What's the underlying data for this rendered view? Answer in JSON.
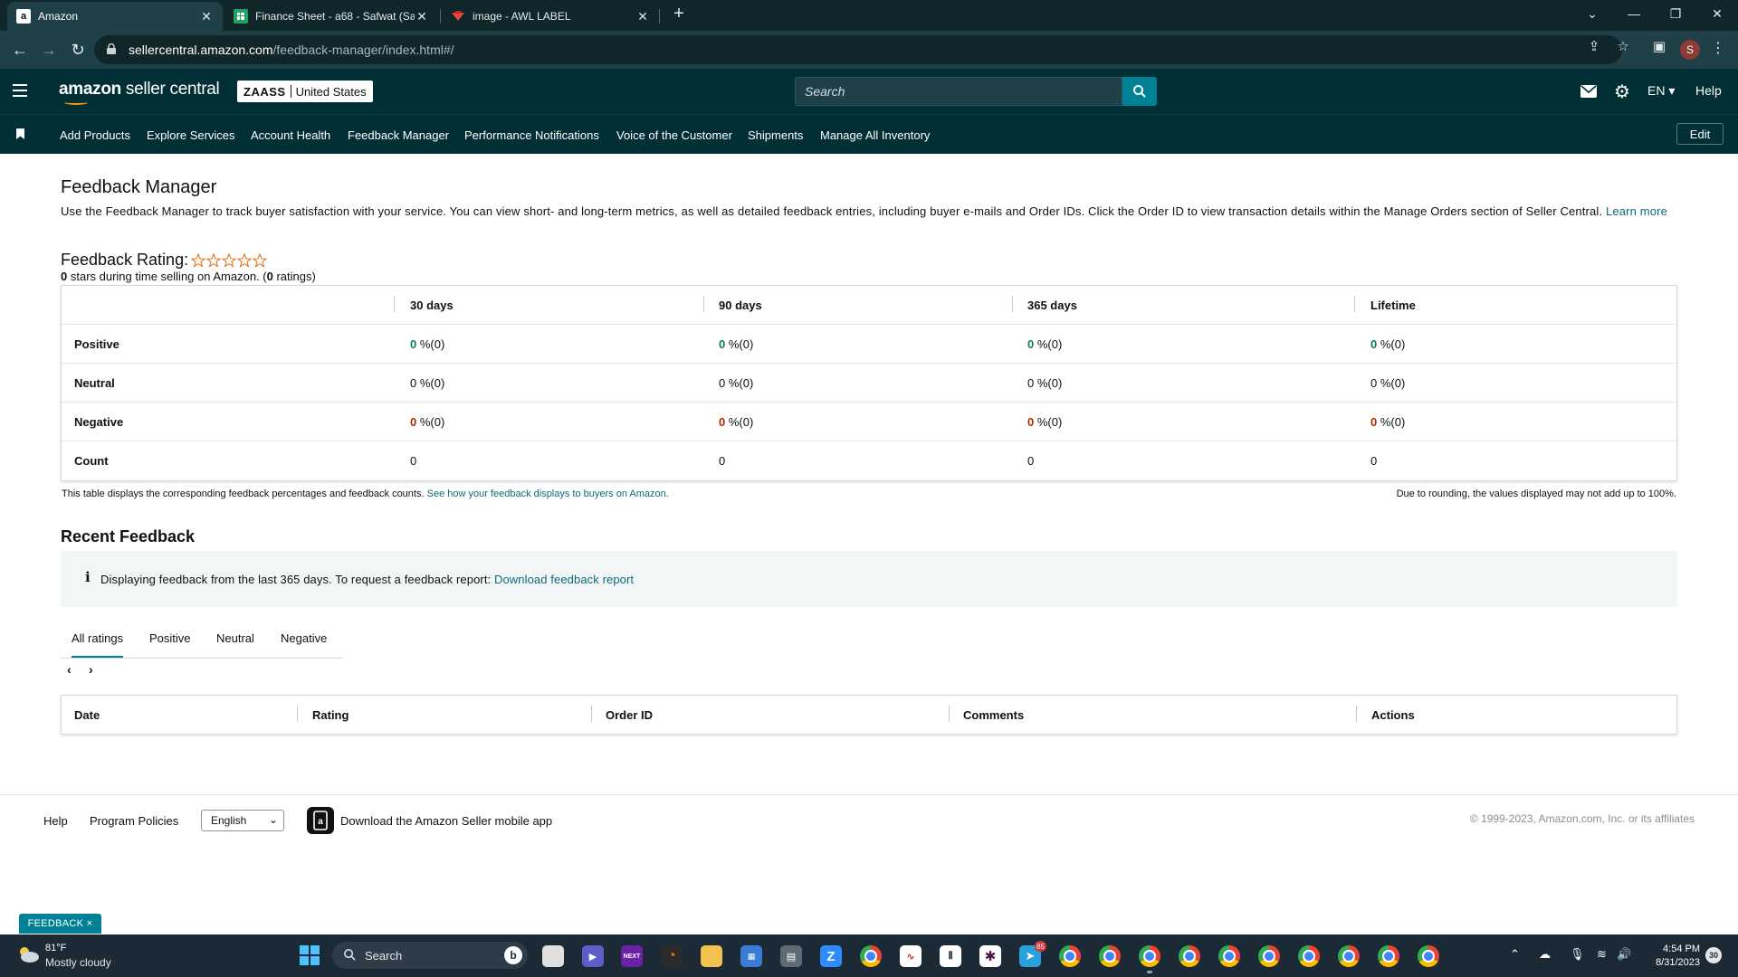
{
  "browser": {
    "tabs": [
      {
        "title": "Amazon",
        "favicon": "a"
      },
      {
        "title": "Finance Sheet - a68 - Safwat (Sar",
        "favicon": "sheets-icon"
      },
      {
        "title": "image - AWL LABEL",
        "favicon": "label-icon"
      }
    ],
    "url_domain": "sellercentral.amazon.com",
    "url_path": "/feedback-manager/index.html#/",
    "profile_initial": "S"
  },
  "header": {
    "logo_brand": "amazon",
    "logo_product": " seller central",
    "store_name": "ZAASS",
    "marketplace": "United States",
    "search_placeholder": "Search",
    "language": "EN",
    "help": "Help"
  },
  "nav": {
    "items": [
      "Add Products",
      "Explore Services",
      "Account Health",
      "Feedback Manager",
      "Performance Notifications",
      "Voice of the Customer",
      "Shipments",
      "Manage All Inventory"
    ],
    "edit": "Edit"
  },
  "page": {
    "title": "Feedback Manager",
    "intro": "Use the Feedback Manager to track buyer satisfaction with your service. You can view short- and long-term metrics, as well as detailed feedback entries, including buyer e-mails and Order IDs. Click the Order ID to view transaction details within the Manage Orders section of Seller Central.",
    "learn_more": "Learn more",
    "rating_title": "Feedback Rating:",
    "rating_stars": 0,
    "rating_stars_value": "0",
    "rating_sub_text": " stars during time selling on Amazon. (",
    "rating_count": "0",
    "rating_sub_end": " ratings)"
  },
  "feedback_table": {
    "columns": [
      "30 days",
      "90 days",
      "365 days",
      "Lifetime"
    ],
    "rows": [
      {
        "label": "Positive",
        "cells": [
          {
            "num": "0",
            "rest": " %(0)"
          },
          {
            "num": "0",
            "rest": " %(0)"
          },
          {
            "num": "0",
            "rest": " %(0)"
          },
          {
            "num": "0",
            "rest": " %(0)"
          }
        ]
      },
      {
        "label": "Neutral",
        "cells": [
          {
            "num": "0",
            "rest": " %(0)"
          },
          {
            "num": "0",
            "rest": " %(0)"
          },
          {
            "num": "0",
            "rest": " %(0)"
          },
          {
            "num": "0",
            "rest": " %(0)"
          }
        ]
      },
      {
        "label": "Negative",
        "cells": [
          {
            "num": "0",
            "rest": " %(0)"
          },
          {
            "num": "0",
            "rest": " %(0)"
          },
          {
            "num": "0",
            "rest": " %(0)"
          },
          {
            "num": "0",
            "rest": " %(0)"
          }
        ]
      },
      {
        "label": "Count",
        "cells": [
          {
            "num": "0",
            "rest": ""
          },
          {
            "num": "0",
            "rest": ""
          },
          {
            "num": "0",
            "rest": ""
          },
          {
            "num": "0",
            "rest": ""
          }
        ]
      }
    ],
    "note_left": "This table displays the corresponding feedback percentages and feedback counts.",
    "note_link": "See how your feedback displays to buyers on Amazon.",
    "note_right": "Due to rounding, the values displayed may not add up to 100%."
  },
  "recent": {
    "title": "Recent Feedback",
    "info_text": "Displaying feedback from the last 365 days. To request a feedback report:",
    "info_link": "Download feedback report",
    "tabs": [
      "All ratings",
      "Positive",
      "Neutral",
      "Negative"
    ],
    "columns": [
      "Date",
      "Rating",
      "Order ID",
      "Comments",
      "Actions"
    ]
  },
  "footer": {
    "help": "Help",
    "policies": "Program Policies",
    "language": "English",
    "app_text": "Download the Amazon Seller mobile app",
    "copyright": "© 1999-2023, Amazon.com, Inc. or its affiliates",
    "feedback_tab": "FEEDBACK ×"
  },
  "taskbar": {
    "temp": "81°F",
    "weather": "Mostly cloudy",
    "search": "Search",
    "time": "4:54 PM",
    "date": "8/31/2023",
    "notifications": "30",
    "telegram_badge": "85",
    "next_label": "NEXT"
  },
  "colors": {
    "header_bg": "#002f36",
    "accent": "#008296",
    "positive": "#067d62",
    "negative": "#b12704",
    "link": "#0b6a7a"
  }
}
